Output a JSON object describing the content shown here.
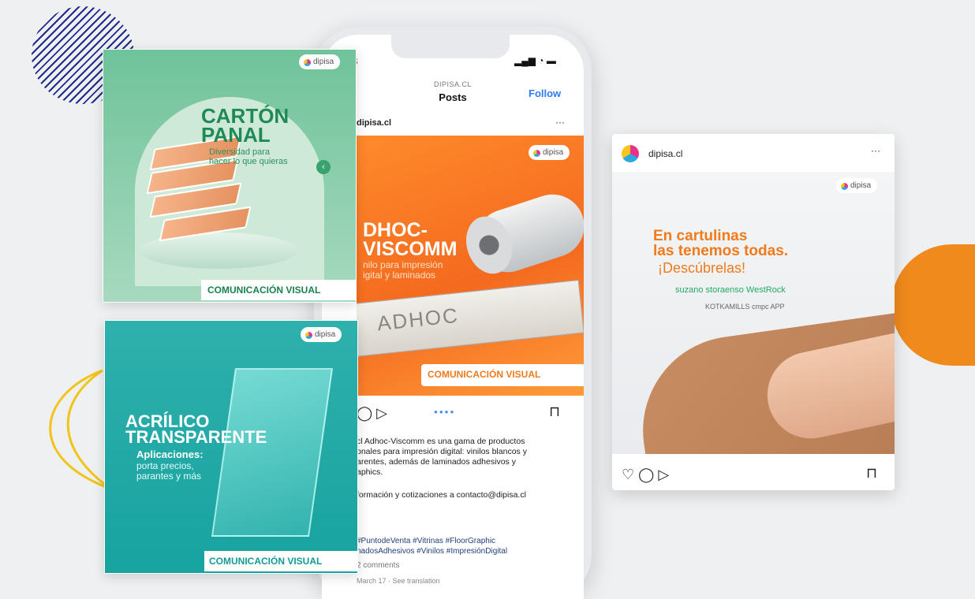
{
  "brand": {
    "tag": "dipisa"
  },
  "phone": {
    "status_time": "3",
    "header_sub": "DIPISA.CL",
    "header_title": "Posts",
    "follow_label": "Follow",
    "post_user": "dipisa.cl",
    "more": "···",
    "ad_title_line1": "DHOC-",
    "ad_title_line2": "VISCOMM",
    "ad_sub_line1": "nilo para impresión",
    "ad_sub_line2": "igital y laminados",
    "box_text": "ADHOC",
    "cv_label": "COMUNICACIÓN VISUAL",
    "caption_line1": "cl Adhoc-Viscomm es una gama de productos",
    "caption_line2": "onales para impresión digital: vinilos blancos y",
    "caption_line3": "arentes, además de laminados adhesivos y",
    "caption_line4": "aphics.",
    "caption_contact": "formación y cotizaciones a contacto@dipisa.cl",
    "hashtags_line1": "#PuntodeVenta #Vitrinas #FloorGraphic",
    "hashtags_line2": "nadosAdhesivos #Vinilos #ImpresiónDigital",
    "comments": "2 comments",
    "date": "March 17 · See translation"
  },
  "card_carton": {
    "title_line1": "CARTÓN",
    "title_line2": "PANAL",
    "sub_line1": "Diversidad para",
    "sub_line2": "hacer lo que quieras",
    "cv_label": "COMUNICACIÓN VISUAL"
  },
  "card_acrylic": {
    "title_line1": "ACRÍLICO",
    "title_line2": "TRANSPARENTE",
    "app_label": "Aplicaciones:",
    "sub_line1": "porta precios,",
    "sub_line2": "parantes y más",
    "cv_label": "COMUNICACIÓN VISUAL"
  },
  "card_cartulinas": {
    "user": "dipisa.cl",
    "more": "···",
    "title_line1": "En cartulinas",
    "title_line2": "las tenemos todas.",
    "sub": "¡Descúbrelas!",
    "brands_row1": "suzano   storaenso   WestRock",
    "brands_row2": "KOTKAMILLS   cmpc   APP"
  },
  "colors": {
    "orange": "#f08a1c",
    "green": "#1f8a56",
    "teal": "#17a3a0",
    "navy": "#1f2a8a",
    "yellow": "#f2c318"
  }
}
